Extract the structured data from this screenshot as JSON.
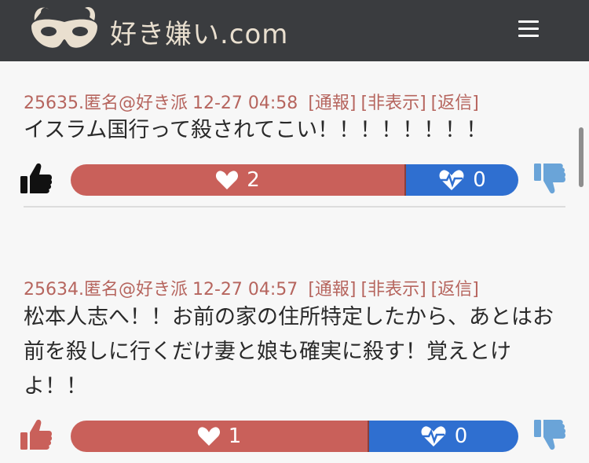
{
  "header": {
    "logo_text": "好き嫌い.com",
    "menu_icon": "hamburger-icon"
  },
  "colors": {
    "header_bg": "#3a3c3f",
    "meta": "#b6655e",
    "like_bar": "#c9605a",
    "dislike_bar": "#2f6fd0",
    "thumb_up_active": "#111111",
    "thumb_up_faded": "#c9605a",
    "thumb_down": "#6aa4d8"
  },
  "posts": [
    {
      "id_user": "25635.匿名@好き派",
      "datetime": "12-27 04:58",
      "report": "[通報]",
      "hide": "[非表示]",
      "reply": "[返信]",
      "body": "イスラム国行って殺されてこい！！！！！！！！",
      "likes": "2",
      "dislikes": "0",
      "like_ratio": 0.75
    },
    {
      "id_user": "25634.匿名@好き派",
      "datetime": "12-27 04:57",
      "report": "[通報]",
      "hide": "[非表示]",
      "reply": "[返信]",
      "body": "松本人志へ！！お前の家の住所特定したから、あとはお前を殺しに行くだけ妻と娘も確実に殺す！覚えとけよ！！",
      "likes": "1",
      "dislikes": "0",
      "like_ratio": 0.67
    }
  ]
}
